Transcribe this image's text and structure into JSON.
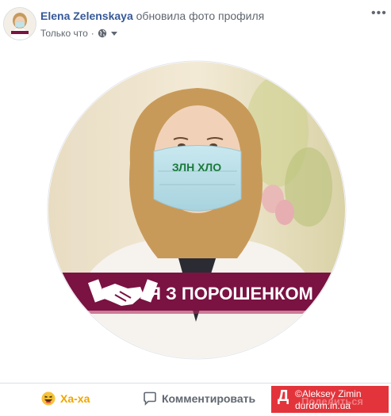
{
  "post": {
    "author": "Elena Zelenskaya",
    "action": "обновила фото профиля",
    "time": "Только что"
  },
  "image": {
    "mask_text": "ЗЛН ХЛО",
    "banner_text": "Я З ПОРОШЕНКОМ"
  },
  "actions": {
    "haha_label": "Ха-ха",
    "comment_label": "Комментировать",
    "share_label": "Поделиться"
  },
  "watermark": {
    "line1": "©Aleksey  Zimin",
    "line2": "durdom.in.ua"
  },
  "colors": {
    "author_link": "#365899",
    "banner": "#7a1242",
    "haha": "#f0a600",
    "watermark_bg": "#e3343b"
  },
  "icons": {
    "privacy": "globe-icon",
    "haha": "haha-emoji-icon",
    "comment": "comment-bubble-icon",
    "banner_logo": "handshake-icon",
    "watermark_logo": "durdom-d-icon"
  }
}
